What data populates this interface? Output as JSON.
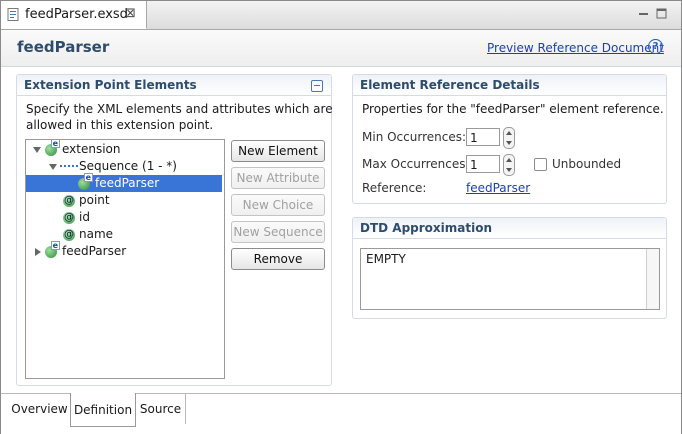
{
  "editor_tab": {
    "label": "feedParser.exsd",
    "close": "⊠"
  },
  "header": {
    "title": "feedParser",
    "preview_link": "Preview Reference Document",
    "help": "?"
  },
  "left": {
    "title": "Extension Point Elements",
    "desc_line1": "Specify the XML elements and attributes which are",
    "desc_line2": "allowed in this extension point.",
    "tree": [
      {
        "label": "extension"
      },
      {
        "label": "Sequence (1 - *)"
      },
      {
        "label": "feedParser"
      },
      {
        "label": "point"
      },
      {
        "label": "id"
      },
      {
        "label": "name"
      },
      {
        "label": "feedParser"
      }
    ],
    "buttons": {
      "new_element": "New Element",
      "new_attribute": "New Attribute",
      "new_choice": "New Choice",
      "new_sequence": "New Sequence",
      "remove": "Remove"
    }
  },
  "details": {
    "title": "Element Reference Details",
    "desc": "Properties for the \"feedParser\" element reference.",
    "min_label": "Min Occurrences:",
    "min_value": "1",
    "max_label": "Max Occurrences:",
    "max_value": "1",
    "unbounded_label": "Unbounded",
    "reference_label": "Reference:",
    "reference_link": "feedParser"
  },
  "dtd": {
    "title": "DTD Approximation",
    "content": "EMPTY"
  },
  "bottom_tabs": {
    "overview": "Overview",
    "definition": "Definition",
    "source": "Source"
  }
}
